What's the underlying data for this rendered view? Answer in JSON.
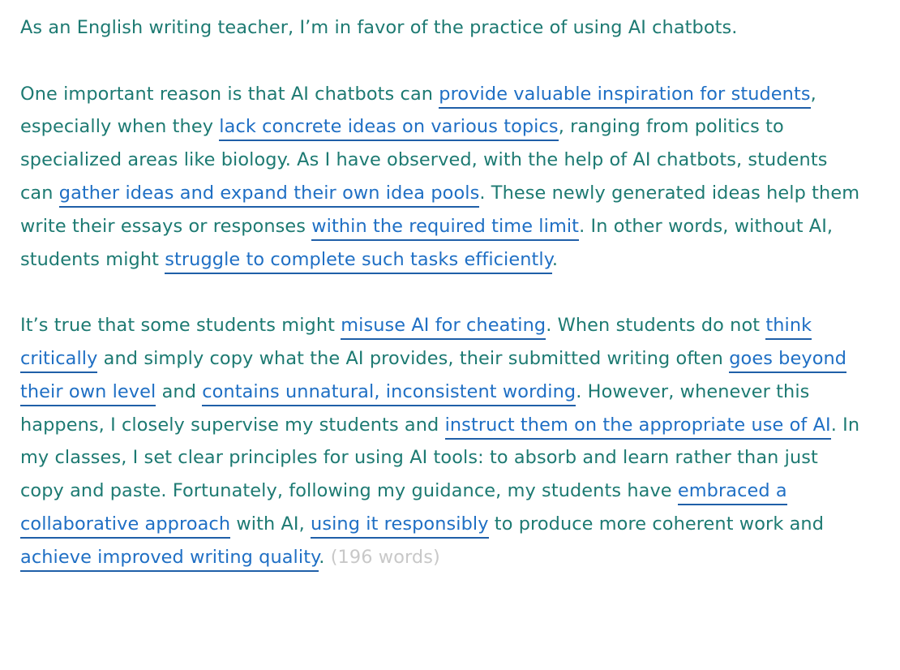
{
  "essay": {
    "paragraphs": [
      [
        {
          "t": "As an English writing teacher, I’m in favor of the practice of using AI chatbots."
        }
      ],
      [
        {
          "t": "One important reason is that AI chatbots can "
        },
        {
          "t": "provide valuable inspiration for students",
          "hl": true
        },
        {
          "t": ", especially when they "
        },
        {
          "t": "lack concrete ideas on various topics",
          "hl": true
        },
        {
          "t": ", ranging from politics to specialized areas like biology. As I have observed, with the help of AI chatbots, students can "
        },
        {
          "t": "gather ideas and expand their own idea pools",
          "hl": true
        },
        {
          "t": ". These newly generated ideas help them write their essays or responses "
        },
        {
          "t": "within the required time limit",
          "hl": true
        },
        {
          "t": ". In other words, without AI, students might "
        },
        {
          "t": "struggle to complete such tasks efficiently",
          "hl": true
        },
        {
          "t": "."
        }
      ],
      [
        {
          "t": "It’s true that some students might "
        },
        {
          "t": "misuse AI for cheating",
          "hl": true
        },
        {
          "t": ". When students do not "
        },
        {
          "t": "think critically",
          "hl": true
        },
        {
          "t": " and simply copy what the AI provides, their submitted writing often "
        },
        {
          "t": "goes beyond their own level",
          "hl": true
        },
        {
          "t": " and "
        },
        {
          "t": "contains unnatural, inconsistent wording",
          "hl": true
        },
        {
          "t": ". However, whenever this happens, I closely supervise my students and "
        },
        {
          "t": "instruct them on the appropriate use of AI",
          "hl": true
        },
        {
          "t": ". In my classes, I set clear principles for using AI tools: to absorb and learn rather than just copy and paste. Fortunately, following my guidance, my students have "
        },
        {
          "t": "embraced a collaborative approach",
          "hl": true
        },
        {
          "t": " with AI, "
        },
        {
          "t": "using it responsibly",
          "hl": true
        },
        {
          "t": " to produce more coherent work and "
        },
        {
          "t": "achieve improved writing quality",
          "hl": true
        },
        {
          "t": ". "
        },
        {
          "t": "(196 words)",
          "wc": true
        }
      ]
    ]
  },
  "colors": {
    "body_text": "#1d7a72",
    "highlight_text": "#1f6fc4",
    "highlight_underline": "#1f5fa8",
    "word_count": "#c8c8c8"
  }
}
